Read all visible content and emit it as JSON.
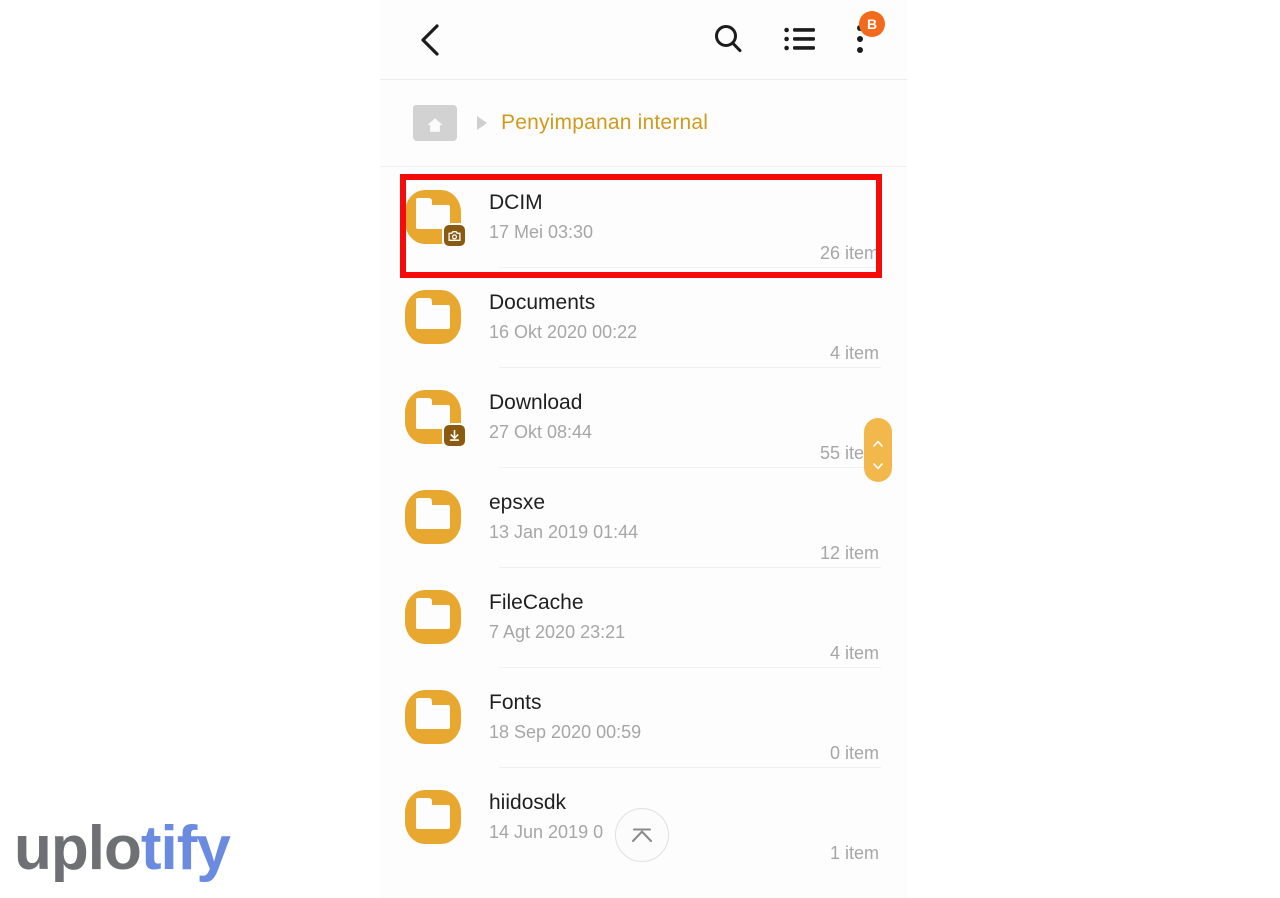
{
  "appbar": {
    "back_icon": "chevron-left-icon",
    "search_icon": "search-icon",
    "listview_icon": "list-view-icon",
    "overflow_icon": "more-vertical-icon",
    "badge_label": "B",
    "badge_color": "#f26b1d"
  },
  "breadcrumb": {
    "home_icon": "folder-home-icon",
    "separator_icon": "triangle-right-icon",
    "path_label": "Penyimpanan internal",
    "path_color": "#d09a1c"
  },
  "list": {
    "rows": [
      {
        "name": "DCIM",
        "date": "17 Mei 03:30",
        "count": "26 item",
        "icon": "folder-camera-icon",
        "badge": "camera",
        "highlighted": true
      },
      {
        "name": "Documents",
        "date": "16 Okt 2020 00:22",
        "count": "4 item",
        "icon": "folder-icon",
        "badge": "none",
        "highlighted": false
      },
      {
        "name": "Download",
        "date": "27 Okt 08:44",
        "count": "55 item",
        "icon": "folder-download-icon",
        "badge": "download",
        "highlighted": false
      },
      {
        "name": "epsxe",
        "date": "13 Jan 2019 01:44",
        "count": "12 item",
        "icon": "folder-icon",
        "badge": "none",
        "highlighted": false
      },
      {
        "name": "FileCache",
        "date": "7 Agt 2020 23:21",
        "count": "4 item",
        "icon": "folder-icon",
        "badge": "none",
        "highlighted": false
      },
      {
        "name": "Fonts",
        "date": "18 Sep 2020 00:59",
        "count": "0 item",
        "icon": "folder-icon",
        "badge": "none",
        "highlighted": false
      },
      {
        "name": "hiidosdk",
        "date": "14 Jun 2019 0",
        "count": "1 item",
        "icon": "folder-icon",
        "badge": "none",
        "highlighted": false
      }
    ]
  },
  "scrollbar": {
    "up_icon": "chevron-up-icon",
    "down_icon": "chevron-down-icon",
    "thumb_color": "#f2b84b"
  },
  "scroll_to_top": {
    "icon": "scroll-to-top-icon"
  },
  "highlight": {
    "color": "#f60b0b"
  },
  "watermark": {
    "part_a": "uplo",
    "part_b": "tify",
    "color_a": "#6f7073",
    "color_b": "#6b8be0"
  }
}
